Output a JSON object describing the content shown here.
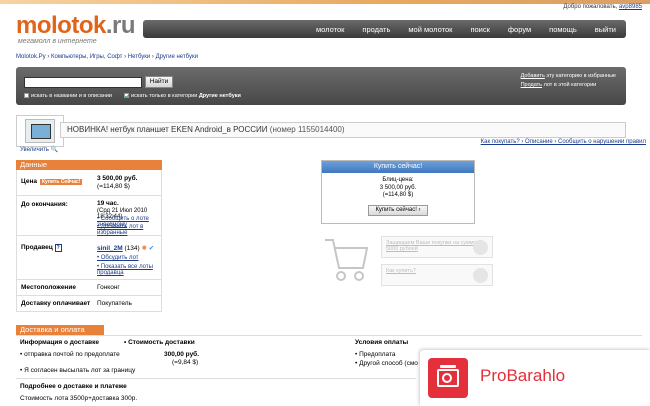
{
  "header": {
    "welcome_prefix": "Добро пожаловать,",
    "username": "avp8985",
    "logo_main": "molotok",
    "logo_dot": ".ru",
    "slogan": "мегамолл в интернете"
  },
  "nav": [
    "молоток",
    "продать",
    "мой молоток",
    "поиск",
    "форум",
    "помощь",
    "выйти"
  ],
  "breadcrumbs": "Molotok.Ру › Компьютеры, Игры, Софт › Нетбуки › Другие нетбуки",
  "search": {
    "placeholder": "",
    "button": "Найти",
    "opt1": "искать в названии и в описании",
    "opt2": "искать только в категории",
    "opt2_cat": "Другие нетбуки",
    "link1_u": "Добавить",
    "link1_rest": " эту категорию в избранные",
    "link2_u": "Продать",
    "link2_rest": " лот в этой категории"
  },
  "lot": {
    "enlarge": "Увеличить",
    "title": "НОВИНКА! нетбук планшет EKEN Android_в РОССИИ",
    "lot_number": "(номер 1155014400)",
    "actions": "Как покупать? › Описание › Сообщить о нарушении правил"
  },
  "data_section": {
    "heading": "Данные",
    "price_label": "Цена",
    "price_badge": "Купить Сейчас!",
    "price_rub": "3 500,00 руб.",
    "price_usd": "(=114,80 $)",
    "end_label": "До окончания:",
    "end_hours": "19 час.",
    "end_date": "(Срд 21 Июл 2010 18:32:44)",
    "end_link1": "• Сообщить о лоте знакомому",
    "end_link2": "• Добавить лот в избранные",
    "seller_label": "Продавец",
    "seller_name": "sinil_2M",
    "seller_score": "(134)",
    "seller_link1": "• Обсудить лот",
    "seller_link2": "• Показать все лоты продавца",
    "location_label": "Местоположение",
    "location_value": "Гонконг",
    "shipping_label": "Доставку оплачивает",
    "shipping_value": "Покупатель"
  },
  "buy_box": {
    "heading": "Купить сейчас!",
    "blitz": "Блиц-цена:",
    "price": "3 500,00 руб.",
    "usd": "(=114,80 $)",
    "button": "Купить сейчас! ›",
    "promo1": "Защищаем Ваши покупки на сумму до 5000 рублей",
    "promo2": "Как купить?"
  },
  "delivery": {
    "heading": "Доставка и оплата",
    "info_h": "Информация о доставке",
    "cost_h": "• Стоимость доставки",
    "pay_h": "Условия оплаты",
    "ship1": "• отправка почтой по предоплате",
    "ship1_rub": "300,00 руб.",
    "ship1_usd": "(=9,84 $)",
    "ship2": "• Я согласен высылать лот за границу",
    "pay1": "• Предоплата",
    "pay2": "• Другой способ (смо",
    "details_h": "Подробнее о доставке и платеже",
    "details": "Стоимость лота 3500р+доставка 300р."
  },
  "overlay": {
    "brand": "ProBarahlo"
  },
  "colors": {
    "accent_orange": "#e8823a",
    "logo_orange": "#e0651a",
    "nav_dark": "#3a3a3a",
    "buy_blue": "#3f78c0",
    "overlay_red": "#e3303a"
  }
}
